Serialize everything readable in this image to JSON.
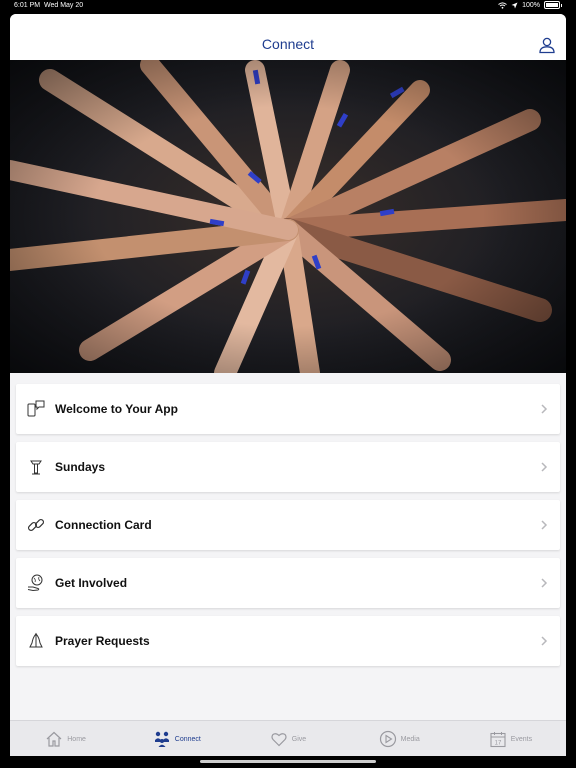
{
  "status_bar": {
    "time": "6:01 PM",
    "date": "Wed May 20",
    "battery": "100%"
  },
  "header": {
    "title": "Connect"
  },
  "hero": {
    "icon": "hands-in-circle-photo"
  },
  "menu": {
    "items": [
      {
        "label": "Welcome to Your App",
        "icon": "devices-chat-icon"
      },
      {
        "label": "Sundays",
        "icon": "podium-icon"
      },
      {
        "label": "Connection Card",
        "icon": "link-icon"
      },
      {
        "label": "Get Involved",
        "icon": "globe-hand-icon"
      },
      {
        "label": "Prayer Requests",
        "icon": "praying-hands-icon"
      }
    ]
  },
  "tabs": [
    {
      "label": "Home",
      "icon": "house-icon",
      "active": false
    },
    {
      "label": "Connect",
      "icon": "people-icon",
      "active": true
    },
    {
      "label": "Give",
      "icon": "heart-icon",
      "active": false
    },
    {
      "label": "Media",
      "icon": "play-icon",
      "active": false
    },
    {
      "label": "Events",
      "icon": "calendar-icon",
      "active": false
    }
  ],
  "colors": {
    "accent": "#1f3d8f",
    "tab_inactive": "#9a9aa0",
    "background": "#f4f4f6"
  }
}
